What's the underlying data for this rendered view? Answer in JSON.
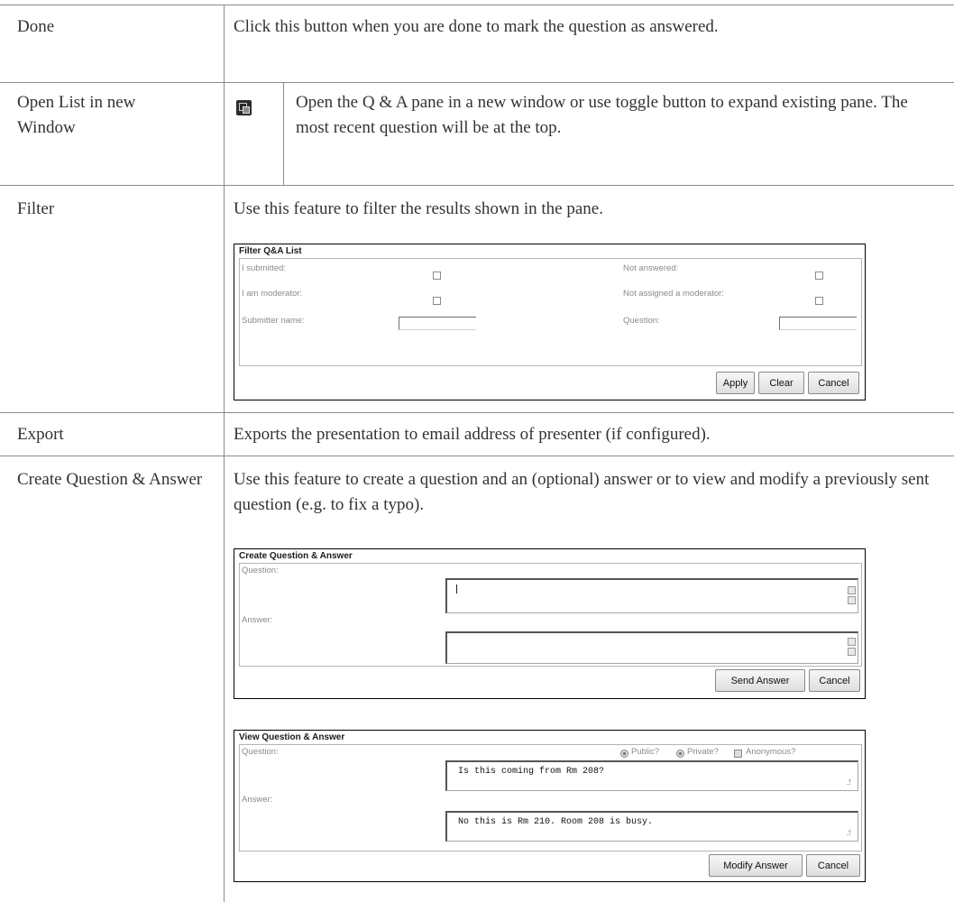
{
  "rows": [
    {
      "label": "Done",
      "description": "Click this button when you are done to mark the question as answered."
    },
    {
      "label": "Open List in new Window",
      "description": "Open the Q & A pane in a new window or use toggle button to expand existing pane. The most recent question will be at the top.",
      "icon": "new-window-icon"
    },
    {
      "label": "Filter",
      "description": "Use this feature to filter the results shown in the pane."
    },
    {
      "label": "Export",
      "description": "Exports the presentation to email address of presenter (if configured)."
    },
    {
      "label": "Create Question & Answer",
      "description": "Use this feature to create a question and an (optional) answer or to view and modify a previously sent question (e.g. to fix a typo)."
    }
  ],
  "filter_dialog": {
    "title": "Filter Q&A List",
    "i_submitted": "I submitted:",
    "not_answered": "Not answered:",
    "i_am_moderator": "I am moderator:",
    "not_assigned": "Not assigned a moderator:",
    "submitter_name": "Submitter name:",
    "question": "Question:",
    "apply": "Apply",
    "clear": "Clear",
    "cancel": "Cancel"
  },
  "create_dialog": {
    "title": "Create Question & Answer",
    "question": "Question:",
    "answer": "Answer:",
    "send_answer": "Send Answer",
    "cancel": "Cancel"
  },
  "view_dialog": {
    "title": "View Question & Answer",
    "question": "Question:",
    "answer": "Answer:",
    "public": "Public?",
    "private": "Private?",
    "anonymous": "Anonymous?",
    "question_text": "Is this coming from Rm 208?",
    "answer_text": "No this is Rm 210. Room 208 is busy.",
    "modify_answer": "Modify Answer",
    "cancel": "Cancel"
  }
}
